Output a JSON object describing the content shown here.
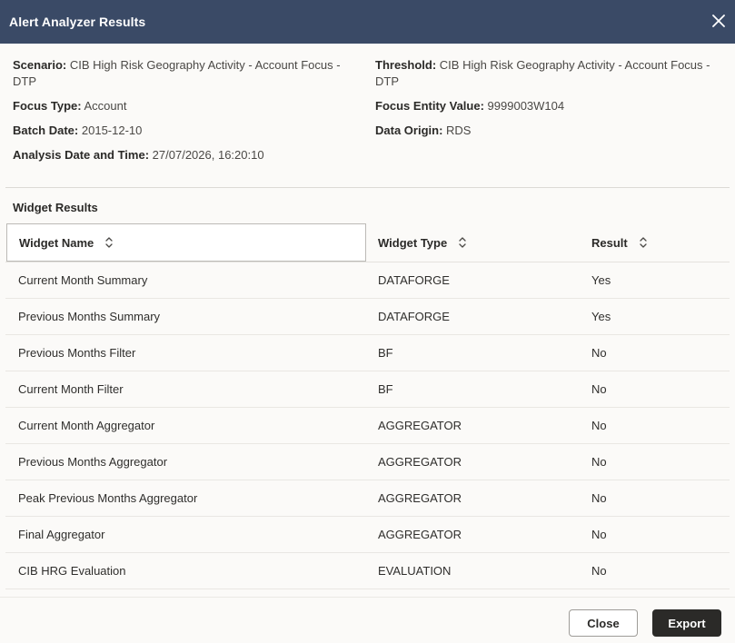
{
  "dialog": {
    "title": "Alert Analyzer Results",
    "close_icon": "close-icon"
  },
  "details": {
    "scenario_label": "Scenario:",
    "scenario_value": "CIB High Risk Geography Activity - Account Focus - DTP",
    "focus_type_label": "Focus Type:",
    "focus_type_value": "Account",
    "batch_date_label": "Batch Date:",
    "batch_date_value": "2015-12-10",
    "analysis_label": "Analysis Date and Time:",
    "analysis_value": "27/07/2026, 16:20:10",
    "threshold_label": "Threshold:",
    "threshold_value": "CIB High Risk Geography Activity - Account Focus - DTP",
    "focus_entity_label": "Focus Entity Value:",
    "focus_entity_value": "9999003W104",
    "data_origin_label": "Data Origin:",
    "data_origin_value": "RDS"
  },
  "widgets": {
    "section_title": "Widget Results",
    "columns": [
      "Widget Name",
      "Widget Type",
      "Result"
    ],
    "sort_icon": "sort-icon",
    "rows": [
      {
        "name": "Current Month Summary",
        "type": "DATAFORGE",
        "result": "Yes"
      },
      {
        "name": "Previous Months Summary",
        "type": "DATAFORGE",
        "result": "Yes"
      },
      {
        "name": "Previous Months Filter",
        "type": "BF",
        "result": "No"
      },
      {
        "name": "Current Month Filter",
        "type": "BF",
        "result": "No"
      },
      {
        "name": "Current Month Aggregator",
        "type": "AGGREGATOR",
        "result": "No"
      },
      {
        "name": "Previous Months Aggregator",
        "type": "AGGREGATOR",
        "result": "No"
      },
      {
        "name": "Peak Previous Months Aggregator",
        "type": "AGGREGATOR",
        "result": "No"
      },
      {
        "name": "Final Aggregator",
        "type": "AGGREGATOR",
        "result": "No"
      },
      {
        "name": "CIB HRG Evaluation",
        "type": "EVALUATION",
        "result": "No"
      }
    ]
  },
  "footer": {
    "close_label": "Close",
    "export_label": "Export"
  },
  "colors": {
    "header_bg": "#3a4a66",
    "primary_button": "#2b2a28"
  }
}
